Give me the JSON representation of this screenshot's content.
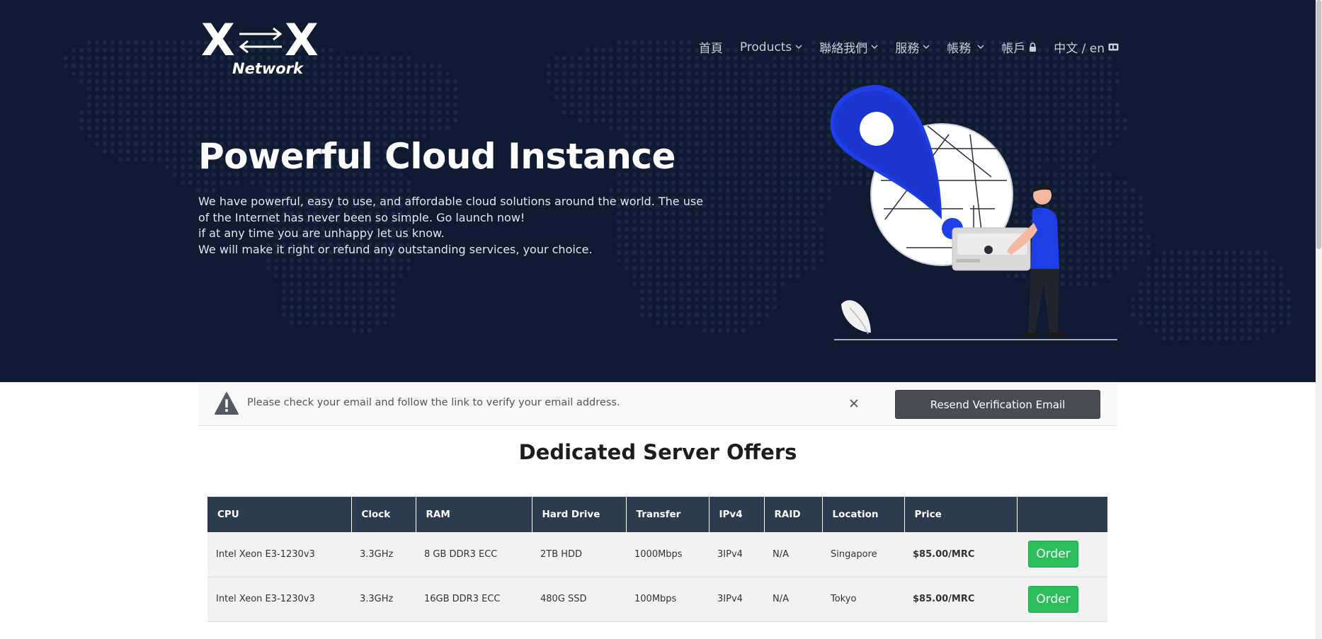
{
  "brand": {
    "logo_letter_left": "X",
    "logo_letter_right": "X",
    "logo_word": "Network",
    "hero_bg": "#101a33",
    "accent_blue": "#1f3fe6"
  },
  "nav": {
    "items": [
      {
        "label": "首頁",
        "icon": null
      },
      {
        "label": "Products",
        "icon": "chevron-down-icon"
      },
      {
        "label": "聯絡我們",
        "icon": "chevron-down-icon"
      },
      {
        "label": "服務",
        "icon": "chevron-down-icon"
      },
      {
        "label": "帳務",
        "icon": "chevron-down-icon"
      },
      {
        "label": "帳戶",
        "icon": "lock-icon"
      },
      {
        "label": "中文 / en",
        "icon": "language-card-icon"
      }
    ]
  },
  "hero": {
    "title": "Powerful Cloud Instance",
    "lines": [
      "We have powerful, easy to use, and affordable cloud solutions around the world. The use",
      "of the Internet has never been so simple. Go launch now!",
      "if at any time you are unhappy let us know.",
      "We will make it right or refund any outstanding services, your choice."
    ]
  },
  "notice": {
    "text": "Please check your email and follow the link to verify your email address.",
    "button_label": "Resend Verification Email",
    "icon": "warning-icon",
    "close_icon": "close-icon"
  },
  "offers": {
    "title": "Dedicated Server Offers",
    "columns": [
      "CPU",
      "Clock",
      "RAM",
      "Hard Drive",
      "Transfer",
      "IPv4",
      "RAID",
      "Location",
      "Price",
      ""
    ],
    "rows": [
      {
        "cpu": "Intel Xeon E3-1230v3",
        "clock": "3.3GHz",
        "ram": "8 GB DDR3 ECC",
        "drive": "2TB HDD",
        "transfer": "1000Mbps",
        "ipv4": "3IPv4",
        "raid": "N/A",
        "location": "Singapore",
        "price": "$85.00/MRC",
        "action": "Order"
      },
      {
        "cpu": "Intel Xeon E3-1230v3",
        "clock": "3.3GHz",
        "ram": "16GB DDR3 ECC",
        "drive": "480G SSD",
        "transfer": "100Mbps",
        "ipv4": "3IPv4",
        "raid": "N/A",
        "location": "Tokyo",
        "price": "$85.00/MRC",
        "action": "Order"
      }
    ],
    "header_bg": "#2d3b4f",
    "price_color": "#2a8fe0",
    "order_color": "#2dbd5a"
  }
}
